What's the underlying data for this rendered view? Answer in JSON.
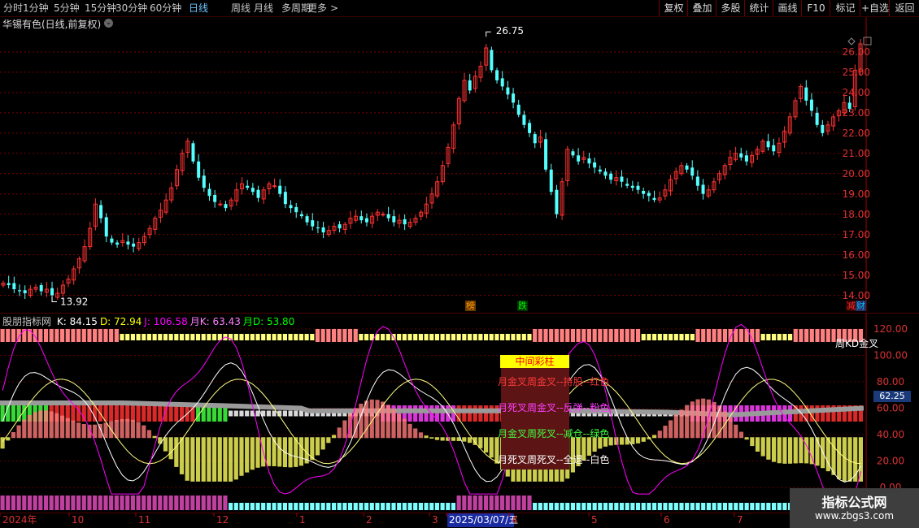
{
  "toolbar": {
    "periods": [
      {
        "label": "分时",
        "active": false
      },
      {
        "label": "1分钟",
        "active": false
      },
      {
        "label": "5分钟",
        "active": false
      },
      {
        "label": "15分钟",
        "active": false
      },
      {
        "label": "30分钟",
        "active": false
      },
      {
        "label": "60分钟",
        "active": false
      },
      {
        "label": "日线",
        "active": true
      },
      {
        "label": "周线",
        "active": false
      },
      {
        "label": "月线",
        "active": false
      },
      {
        "label": "多周期",
        "active": false
      },
      {
        "label": "更多",
        "active": false
      }
    ],
    "more_chevron": ">",
    "right_buttons": [
      "复权",
      "叠加",
      "多股",
      "统计",
      "画线",
      "F10",
      "标记",
      "+自选",
      "返回"
    ]
  },
  "stock": {
    "title": "华锡有色(日线,前复权)",
    "high_label": "26.75",
    "low_label": "13.92",
    "price_ticks": [
      "26.00",
      "25.00",
      "24.00",
      "23.00",
      "22.00",
      "21.00",
      "20.00",
      "19.00",
      "18.00",
      "17.00",
      "16.00",
      "15.00",
      "14.00"
    ],
    "colors": {
      "up": "#ff3232",
      "down": "#54ffff",
      "axis": "#dc3232",
      "grid": "#7a0000"
    }
  },
  "signals": [
    {
      "label": "榜",
      "color": "#ff9900",
      "bg": "#6a3a00"
    },
    {
      "label": "跌",
      "color": "#00ff00",
      "bg": "#003300"
    },
    {
      "label": "减",
      "color": "#ff3232",
      "bg": "#3a0000"
    },
    {
      "label": "财",
      "color": "#00bfff",
      "bg": "#2a2a5a"
    }
  ],
  "indicator": {
    "name": "股朋指标网",
    "values": [
      {
        "label": "K: 84.15",
        "color": "#ffffff"
      },
      {
        "label": "D: 72.94",
        "color": "#ffff00"
      },
      {
        "label": "J: 106.58",
        "color": "#ff00ff"
      },
      {
        "label": "月K: 63.43",
        "color": "#ff80ff"
      },
      {
        "label": "月D: 53.80",
        "color": "#00ff00"
      }
    ],
    "ticks": [
      "120.00",
      "100.00",
      "80.00",
      "60.00",
      "40.00",
      "20.00",
      "0.00"
    ],
    "current_value": "62.25",
    "kd_label": "周KD金叉"
  },
  "overlay": {
    "title": "中间彩柱",
    "lines": [
      {
        "text": "月金叉周金叉--持股--红色",
        "color": "#ff3a3a"
      },
      {
        "text": "月死叉周金叉--反弹--粉色",
        "color": "#ff40ff"
      },
      {
        "text": "月金叉周死叉--减仓--绿色",
        "color": "#40ff40"
      },
      {
        "text": "月死叉周死叉--全退--白色",
        "color": "#ffffff"
      }
    ]
  },
  "date_axis": {
    "labels": [
      "2024年",
      "10",
      "11",
      "12",
      "1",
      "2",
      "3",
      "2025/03/07/五",
      "4",
      "5",
      "6",
      "7"
    ],
    "highlight": "2025/03/07/五"
  },
  "watermark": {
    "line1": "指标公式网",
    "line2": "www.zbgs3.com"
  },
  "chart_data": {
    "type": "candlestick",
    "title": "华锡有色(日线,前复权)",
    "ylim": [
      13.5,
      27.0
    ],
    "high": 26.75,
    "low": 13.92,
    "close_series": [
      14.6,
      14.5,
      14.3,
      14.2,
      14.1,
      14.3,
      14.4,
      14.2,
      14.3,
      14.0,
      14.1,
      14.5,
      14.8,
      15.3,
      15.8,
      16.4,
      17.3,
      18.5,
      17.8,
      16.9,
      16.6,
      16.5,
      16.7,
      16.5,
      16.4,
      16.6,
      16.9,
      17.3,
      17.8,
      18.2,
      18.7,
      19.3,
      20.2,
      21.0,
      21.6,
      20.6,
      19.8,
      19.3,
      18.9,
      18.6,
      18.5,
      18.3,
      18.7,
      19.2,
      19.5,
      19.3,
      19.1,
      18.8,
      19.2,
      19.5,
      19.4,
      19.0,
      18.5,
      18.3,
      18.1,
      17.9,
      17.6,
      17.4,
      17.3,
      17.1,
      17.2,
      17.4,
      17.3,
      17.5,
      17.8,
      17.9,
      17.7,
      17.6,
      17.9,
      18.1,
      18.0,
      17.8,
      17.6,
      17.7,
      17.5,
      17.6,
      17.8,
      18.1,
      18.5,
      19.0,
      19.6,
      20.4,
      21.3,
      22.4,
      23.7,
      24.6,
      24.1,
      24.8,
      25.3,
      26.2,
      25.1,
      24.6,
      24.3,
      23.9,
      23.5,
      22.9,
      22.4,
      22.0,
      21.5,
      21.8,
      20.2,
      19.1,
      18.0,
      19.6,
      21.2,
      20.9,
      20.6,
      20.8,
      20.5,
      20.3,
      20.1,
      19.9,
      19.7,
      19.8,
      19.6,
      19.4,
      19.3,
      19.2,
      19.0,
      18.9,
      18.7,
      18.8,
      19.2,
      19.7,
      20.1,
      20.4,
      20.2,
      19.9,
      19.4,
      19.0,
      19.2,
      19.6,
      20.0,
      20.4,
      20.8,
      21.0,
      20.8,
      20.6,
      20.9,
      21.2,
      21.6,
      21.3,
      21.1,
      21.5,
      22.1,
      22.8,
      23.6,
      24.3,
      23.6,
      23.1,
      22.4,
      22.0,
      22.4,
      22.8,
      23.1,
      23.5,
      23.2,
      25.1,
      26.4
    ]
  }
}
